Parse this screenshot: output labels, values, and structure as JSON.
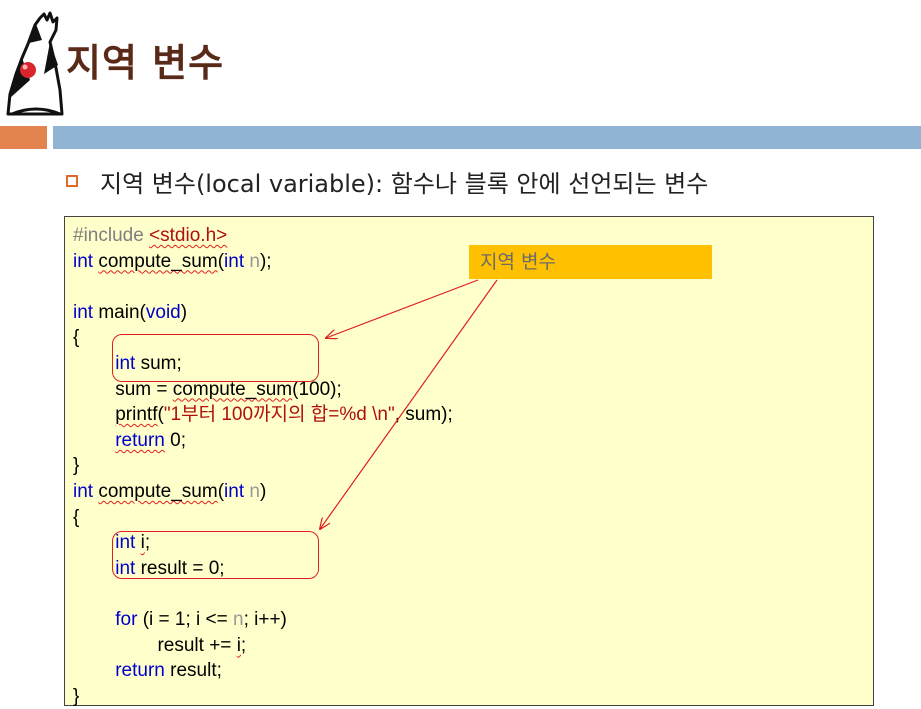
{
  "slide": {
    "title": "지역 변수",
    "bullet": "지역 변수(local variable): 함수나 블록 안에 선언되는 변수",
    "callout": "지역 변수"
  },
  "code": {
    "include_directive": "#include",
    "include_file": "<stdio.h>",
    "kw_int": "int",
    "kw_void": "void",
    "kw_return": "return",
    "kw_for": "for",
    "fn_compute_sum": "compute_sum",
    "fn_main": "main",
    "fn_printf": "printf",
    "param_n": "n",
    "proto_end": ");",
    "paren_open": "(",
    "paren_close": ")",
    "brace_open": "{",
    "brace_close": "}",
    "decl_sum": "sum;",
    "assign_lhs": "sum = ",
    "call_arg_100": "(100);",
    "printf_string": "\"1부터 100까지의 합=%d \\n\"",
    "printf_rest": ", sum);",
    "return_zero": "0;",
    "decl_i_name": "i",
    "semicolon": ";",
    "decl_result": "result = 0;",
    "for_head_a": "(i = 1; i <= ",
    "for_head_b": "; i++)",
    "accum_a": "result += ",
    "return_result": "result;"
  },
  "colors": {
    "title": "#5a2a18",
    "accent_bar_orange": "#e3834f",
    "accent_bar_blue": "#91b3d4",
    "code_background": "#ffffcc",
    "keyword": "#0000cc",
    "string": "#b01010",
    "callout": "#ffc000",
    "annotation_red": "#e02020"
  },
  "icons": [
    "duke-mascot-logo",
    "square-bullet-icon",
    "arrow-icon"
  ]
}
